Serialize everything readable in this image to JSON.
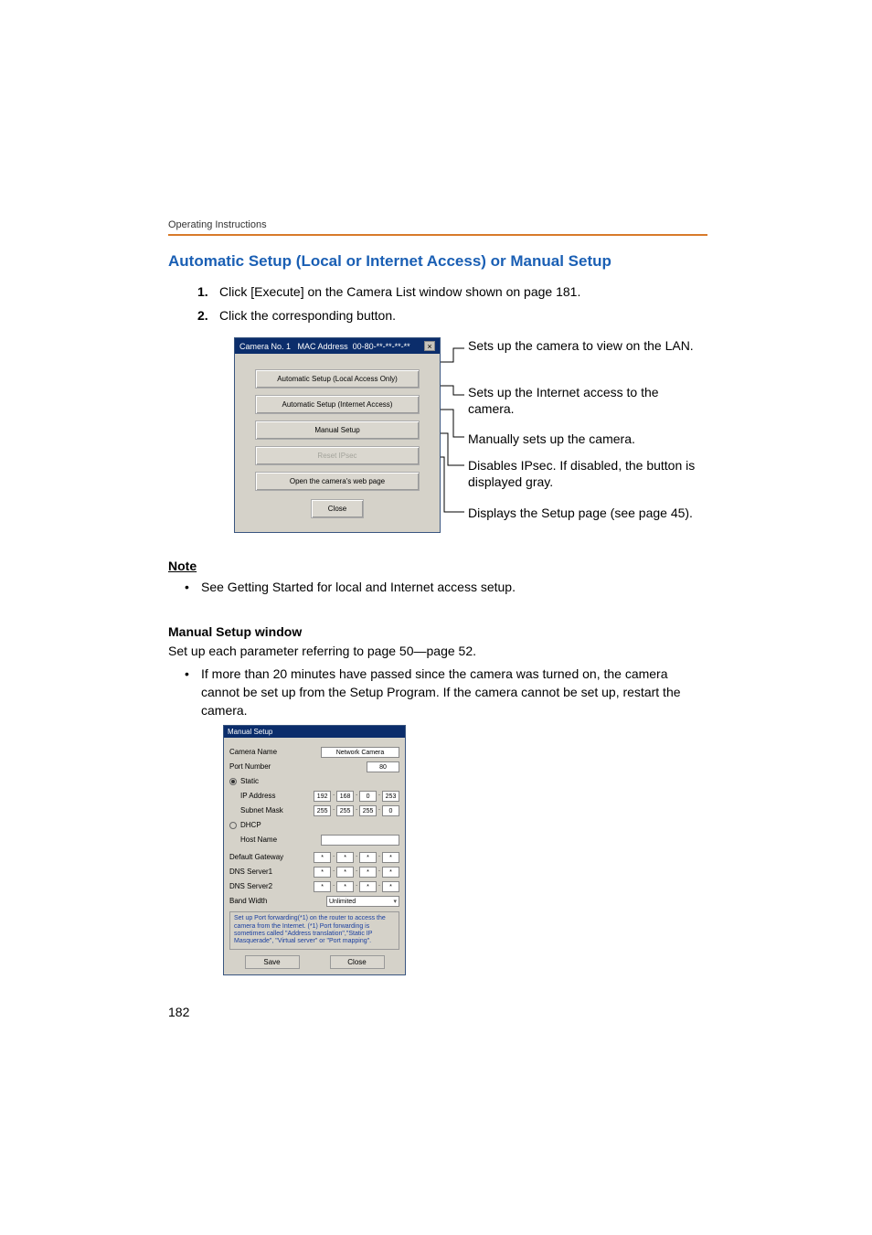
{
  "running_header": "Operating Instructions",
  "section_title": "Automatic Setup (Local or Internet Access) or Manual Setup",
  "steps": [
    {
      "num": "1.",
      "text": "Click [Execute] on the Camera List window shown on page 181."
    },
    {
      "num": "2.",
      "text": "Click the corresponding button."
    }
  ],
  "dialog1": {
    "title_prefix": "Camera  No. 1",
    "title_mac_label": "MAC Address",
    "title_mac_value": "00-80-**-**-**-**",
    "buttons": {
      "auto_local": "Automatic Setup (Local Access Only)",
      "auto_internet": "Automatic Setup (Internet Access)",
      "manual": "Manual Setup",
      "reset_ipsec": "Reset IPsec",
      "open_web": "Open the camera's web page",
      "close": "Close"
    }
  },
  "callouts": {
    "c1": "Sets up the camera to view on the LAN.",
    "c2": "Sets up the Internet access to the camera.",
    "c3": "Manually sets up the camera.",
    "c4": "Disables IPsec. If disabled, the button is displayed gray.",
    "c5": "Displays the Setup page (see page 45)."
  },
  "note_heading": "Note",
  "note_bullet": "See Getting Started for local and Internet access setup.",
  "manual_setup_heading": "Manual Setup window",
  "manual_setup_intro": "Set up each parameter referring to page 50—page 52.",
  "manual_setup_bullet": "If more than 20 minutes have passed since the camera was turned on, the camera cannot be set up from the Setup Program. If the camera cannot be set up, restart the camera.",
  "ms_dialog": {
    "title": "Manual Setup",
    "camera_name_label": "Camera Name",
    "camera_name_value": "Network Camera",
    "port_label": "Port Number",
    "port_value": "80",
    "static_label": "Static",
    "ip_label": "IP Address",
    "ip": [
      "192",
      "168",
      "0",
      "253"
    ],
    "subnet_label": "Subnet Mask",
    "subnet": [
      "255",
      "255",
      "255",
      "0"
    ],
    "dhcp_label": "DHCP",
    "host_label": "Host Name",
    "gateway_label": "Default Gateway",
    "gateway": [
      "*",
      "*",
      "*",
      "*"
    ],
    "dns1_label": "DNS Server1",
    "dns1": [
      "*",
      "*",
      "*",
      "*"
    ],
    "dns2_label": "DNS Server2",
    "dns2": [
      "*",
      "*",
      "*",
      "*"
    ],
    "band_label": "Band Width",
    "band_value": "Unlimited",
    "footer_note": "Set up Port forwarding(*1) on the router to access the camera from the Internet. (*1) Port forwarding is sometimes called \"Address translation\",\"Static IP Masquerade\", \"Virtual server\" or \"Port mapping\".",
    "save": "Save",
    "close": "Close"
  },
  "page_number": "182"
}
